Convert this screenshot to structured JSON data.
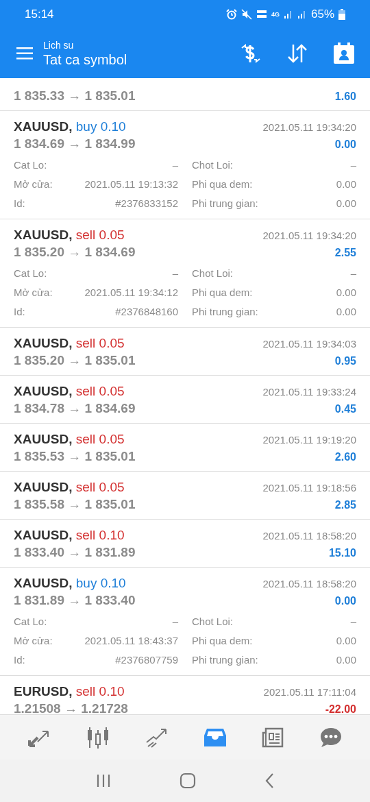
{
  "status_bar": {
    "time": "15:14",
    "battery": "65%",
    "network": "4G"
  },
  "app_bar": {
    "subtitle": "Lich su",
    "title": "Tat ca symbol"
  },
  "trades": [
    {
      "prices": "1 835.33 → 1 835.01",
      "profit": "1.60",
      "loss": false,
      "expanded": false
    },
    {
      "symbol": "XAUUSD,",
      "buy": true,
      "volume": "buy 0.10",
      "time": "2021.05.11 19:34:20",
      "prices": "1 834.69 → 1 834.99",
      "profit": "0.00",
      "loss": false,
      "expanded": true,
      "details": [
        {
          "label": "Cat Lo:",
          "value": "–"
        },
        {
          "label": "Chot Loi:",
          "value": "–"
        },
        {
          "label": "Mở cửa:",
          "value": "2021.05.11 19:13:32"
        },
        {
          "label": "Phi qua dem:",
          "value": "0.00"
        },
        {
          "label": "Id:",
          "value": "#2376833152"
        },
        {
          "label": "Phi trung gian:",
          "value": "0.00"
        }
      ]
    },
    {
      "symbol": "XAUUSD,",
      "buy": false,
      "volume": "sell 0.05",
      "time": "2021.05.11 19:34:20",
      "prices": "1 835.20 → 1 834.69",
      "profit": "2.55",
      "loss": false,
      "expanded": true,
      "details": [
        {
          "label": "Cat Lo:",
          "value": "–"
        },
        {
          "label": "Chot Loi:",
          "value": "–"
        },
        {
          "label": "Mở cửa:",
          "value": "2021.05.11 19:34:12"
        },
        {
          "label": "Phi qua dem:",
          "value": "0.00"
        },
        {
          "label": "Id:",
          "value": "#2376848160"
        },
        {
          "label": "Phi trung gian:",
          "value": "0.00"
        }
      ]
    },
    {
      "symbol": "XAUUSD,",
      "buy": false,
      "volume": "sell 0.05",
      "time": "2021.05.11 19:34:03",
      "prices": "1 835.20 → 1 835.01",
      "profit": "0.95",
      "loss": false,
      "expanded": false
    },
    {
      "symbol": "XAUUSD,",
      "buy": false,
      "volume": "sell 0.05",
      "time": "2021.05.11 19:33:24",
      "prices": "1 834.78 → 1 834.69",
      "profit": "0.45",
      "loss": false,
      "expanded": false
    },
    {
      "symbol": "XAUUSD,",
      "buy": false,
      "volume": "sell 0.05",
      "time": "2021.05.11 19:19:20",
      "prices": "1 835.53 → 1 835.01",
      "profit": "2.60",
      "loss": false,
      "expanded": false
    },
    {
      "symbol": "XAUUSD,",
      "buy": false,
      "volume": "sell 0.05",
      "time": "2021.05.11 19:18:56",
      "prices": "1 835.58 → 1 835.01",
      "profit": "2.85",
      "loss": false,
      "expanded": false
    },
    {
      "symbol": "XAUUSD,",
      "buy": false,
      "volume": "sell 0.10",
      "time": "2021.05.11 18:58:20",
      "prices": "1 833.40 → 1 831.89",
      "profit": "15.10",
      "loss": false,
      "expanded": false
    },
    {
      "symbol": "XAUUSD,",
      "buy": true,
      "volume": "buy 0.10",
      "time": "2021.05.11 18:58:20",
      "prices": "1 831.89 → 1 833.40",
      "profit": "0.00",
      "loss": false,
      "expanded": true,
      "details": [
        {
          "label": "Cat Lo:",
          "value": "–"
        },
        {
          "label": "Chot Loi:",
          "value": "–"
        },
        {
          "label": "Mở cửa:",
          "value": "2021.05.11 18:43:37"
        },
        {
          "label": "Phi qua dem:",
          "value": "0.00"
        },
        {
          "label": "Id:",
          "value": "#2376807759"
        },
        {
          "label": "Phi trung gian:",
          "value": "0.00"
        }
      ]
    },
    {
      "symbol": "EURUSD,",
      "buy": false,
      "volume": "sell 0.10",
      "time": "2021.05.11 17:11:04",
      "prices": "1.21508 → 1.21728",
      "profit": "-22.00",
      "loss": true,
      "expanded": false
    }
  ],
  "bottom_nav": [
    {
      "kind": "quotes",
      "selected": false
    },
    {
      "kind": "chart",
      "selected": false
    },
    {
      "kind": "trade",
      "selected": false
    },
    {
      "kind": "history",
      "selected": true
    },
    {
      "kind": "news",
      "selected": false
    },
    {
      "kind": "chat",
      "selected": false
    }
  ]
}
